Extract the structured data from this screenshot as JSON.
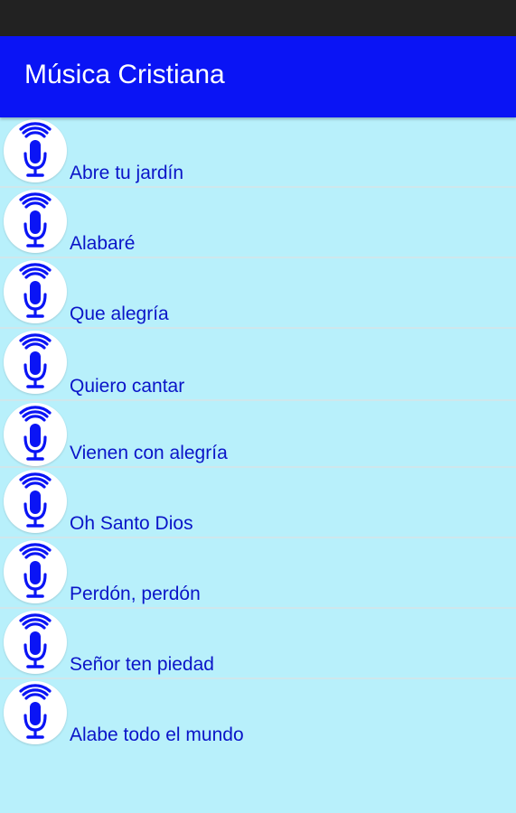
{
  "app_bar": {
    "title": "Música Cristiana",
    "background_color": "#0a14f5"
  },
  "list": {
    "background_color": "#b8f0fb",
    "text_color": "#0a14c8",
    "item_icon": "microphone-icon",
    "items": [
      {
        "label": "Abre tu jardín"
      },
      {
        "label": "Alabaré"
      },
      {
        "label": "Que alegría"
      },
      {
        "label": "Quiero cantar"
      },
      {
        "label": "Vienen con alegría"
      },
      {
        "label": "Oh Santo Dios"
      },
      {
        "label": "Perdón, perdón"
      },
      {
        "label": "Señor ten piedad"
      },
      {
        "label": "Alabe todo el mundo"
      }
    ]
  }
}
